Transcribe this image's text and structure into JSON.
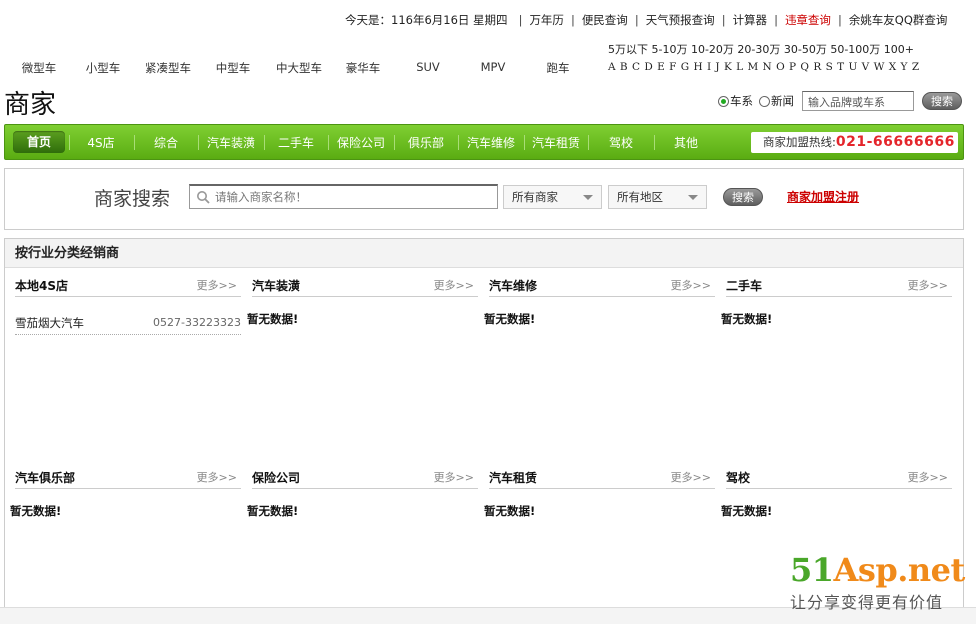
{
  "topbar": {
    "today": "今天是：116年6月16日 星期四",
    "links": [
      {
        "label": "万年历",
        "red": false
      },
      {
        "label": "便民查询",
        "red": false
      },
      {
        "label": "天气预报查询",
        "red": false
      },
      {
        "label": "计算器",
        "red": false
      },
      {
        "label": "违章查询",
        "red": true
      },
      {
        "label": "余姚车友QQ群查询",
        "red": false
      }
    ]
  },
  "car_types": [
    "微型车",
    "小型车",
    "紧凑型车",
    "中型车",
    "中大型车",
    "豪华车",
    "SUV",
    "MPV",
    "跑车"
  ],
  "prices": "5万以下 5-10万 10-20万 20-30万 30-50万 50-100万 100+",
  "letters": "A B C D E F G H I J K L M N O P Q R S T U V W X Y Z",
  "page_title": "商家",
  "header_search": {
    "radio_car": "车系",
    "radio_news": "新闻",
    "placeholder": "输入品牌或车系",
    "button": "搜索"
  },
  "nav": {
    "home": "首页",
    "items": [
      "4S店",
      "综合",
      "汽车装潢",
      "二手车",
      "保险公司",
      "俱乐部",
      "汽车维修",
      "汽车租赁",
      "驾校",
      "其他"
    ],
    "hotline_label": "商家加盟热线:",
    "hotline_number": "021-66666666"
  },
  "merchant_search": {
    "label": "商家搜索",
    "placeholder": "请输入商家名称！",
    "select_type": "所有商家",
    "select_area": "所有地区",
    "button": "搜索",
    "join_link": "商家加盟注册"
  },
  "dealers": {
    "heading": "按行业分类经销商",
    "more": "更多>>",
    "empty": "暂无数据!",
    "categories": [
      {
        "title": "本地4S店"
      },
      {
        "title": "汽车装潢"
      },
      {
        "title": "汽车维修"
      },
      {
        "title": "二手车"
      },
      {
        "title": "汽车俱乐部"
      },
      {
        "title": "保险公司"
      },
      {
        "title": "汽车租赁"
      },
      {
        "title": "驾校"
      }
    ],
    "shop": {
      "name": "雪茄烟大汽车",
      "phone": "0527-33223323"
    }
  },
  "watermark": {
    "brand_a": "51",
    "brand_b": "Asp.net",
    "slogan": "让分享变得更有价值"
  },
  "colors": {
    "nav_green": "#6cbf22",
    "hotline_red": "#e4252b",
    "link_red": "#cc0000",
    "brand_orange": "#f08a1a",
    "brand_green": "#4aa72a"
  }
}
